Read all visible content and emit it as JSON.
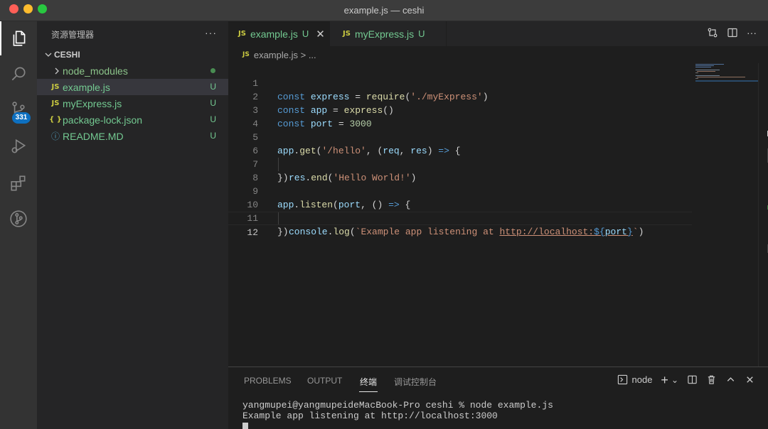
{
  "window": {
    "title": "example.js — ceshi"
  },
  "activity_bar": {
    "items": [
      {
        "icon": "files-icon",
        "active": true
      },
      {
        "icon": "search-icon"
      },
      {
        "icon": "source-control-icon",
        "badge": "331"
      },
      {
        "icon": "run-debug-icon"
      },
      {
        "icon": "extensions-icon"
      },
      {
        "icon": "git-graph-icon"
      }
    ]
  },
  "sidebar": {
    "title": "资源管理器",
    "more": "···",
    "folder": "CESHI",
    "items": [
      {
        "name": "node_modules",
        "type": "folder",
        "status": "dot"
      },
      {
        "name": "example.js",
        "type": "js",
        "icon_text": "JS",
        "status": "U",
        "selected": true
      },
      {
        "name": "myExpress.js",
        "type": "js",
        "icon_text": "JS",
        "status": "U"
      },
      {
        "name": "package-lock.json",
        "type": "json",
        "icon_text": "{ }",
        "status": "U"
      },
      {
        "name": "README.MD",
        "type": "info",
        "icon_text": "ⓘ",
        "status": "U"
      }
    ]
  },
  "tabs": [
    {
      "icon_text": "JS",
      "label": "example.js",
      "status": "U",
      "close": "✕",
      "active": true
    },
    {
      "icon_text": "JS",
      "label": "myExpress.js",
      "status": "U",
      "active": false
    }
  ],
  "breadcrumb": {
    "icon_text": "JS",
    "file": "example.js",
    "sep": " > ",
    "rest": "..."
  },
  "editor": {
    "lines": [
      "1",
      "2",
      "3",
      "4",
      "5",
      "6",
      "7",
      "8",
      "9",
      "10",
      "11",
      "12"
    ],
    "current_line": "12",
    "code": {
      "l1": {
        "kw": "const",
        "var": "express",
        "op": " = ",
        "fn": "require",
        "p1": "(",
        "str": "'./myExpress'",
        "p2": ")"
      },
      "l2": {
        "kw": "const",
        "var": "app",
        "op": " = ",
        "fn": "express",
        "p": "()"
      },
      "l3": {
        "kw": "const",
        "var": "port",
        "op": " = ",
        "num": "3000"
      },
      "l5": {
        "var": "app",
        "dot": ".",
        "fn": "get",
        "p1": "(",
        "str": "'/hello'",
        "c": ", (",
        "a1": "req",
        "c2": ", ",
        "a2": "res",
        "c3": ") ",
        "arrow": "=>",
        "b": " {"
      },
      "l6": {
        "var": "res",
        "dot": ".",
        "fn": "end",
        "p1": "(",
        "str": "'Hello World!'",
        "p2": ")"
      },
      "l7": {
        "t": "})"
      },
      "l9": {
        "var": "app",
        "dot": ".",
        "fn": "listen",
        "p1": "(",
        "a1": "port",
        "c": ", () ",
        "arrow": "=>",
        "b": " {"
      },
      "l10": {
        "var": "console",
        "dot": ".",
        "fn": "log",
        "p1": "(",
        "s1": "`Example app listening at ",
        "url": "http://localhost:",
        "t1": "${",
        "tv": "port",
        "t2": "}",
        "s2": "`",
        "p2": ")"
      },
      "l11": {
        "t": "})"
      }
    }
  },
  "panel": {
    "tabs": [
      "PROBLEMS",
      "OUTPUT",
      "终端",
      "调试控制台"
    ],
    "active_tab": "终端",
    "terminal_name": "node",
    "plus": "+",
    "chevron": "⌄",
    "terminal_lines": [
      "yangmupei@yangmupeideMacBook-Pro ceshi % node example.js",
      "Example app listening at http://localhost:3000"
    ]
  },
  "colors": {
    "accent_badge": "#0e70c0",
    "untracked_green": "#73c991",
    "js_yellow": "#cbcb41"
  }
}
